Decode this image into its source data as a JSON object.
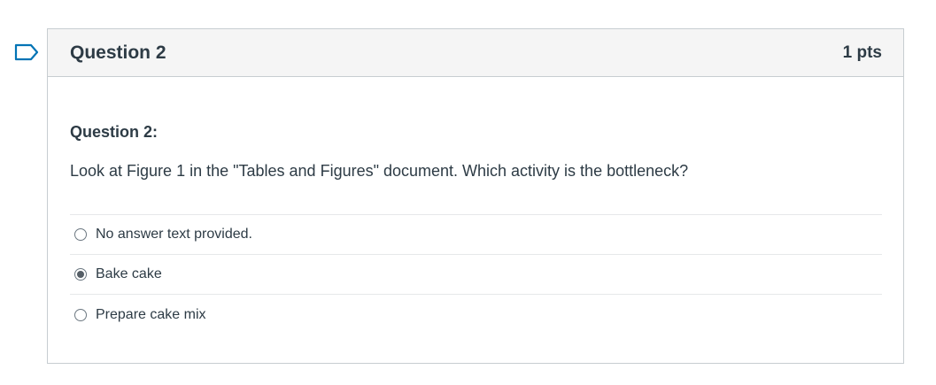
{
  "question": {
    "title": "Question 2",
    "points": "1 pts",
    "subtitle": "Question 2:",
    "text": "Look at Figure 1 in the \"Tables and Figures\" document. Which activity is the bottleneck?"
  },
  "answers": [
    {
      "label": "No answer text provided.",
      "selected": false
    },
    {
      "label": "Bake cake",
      "selected": true
    },
    {
      "label": "Prepare cake mix",
      "selected": false
    }
  ],
  "colors": {
    "flag": "#0374b5",
    "header_bg": "#f5f5f5",
    "text": "#2d3b45",
    "border": "#c7cdd1"
  },
  "icons": {
    "flag": "bookmark-flag-icon",
    "radio": "radio-button-icon"
  }
}
